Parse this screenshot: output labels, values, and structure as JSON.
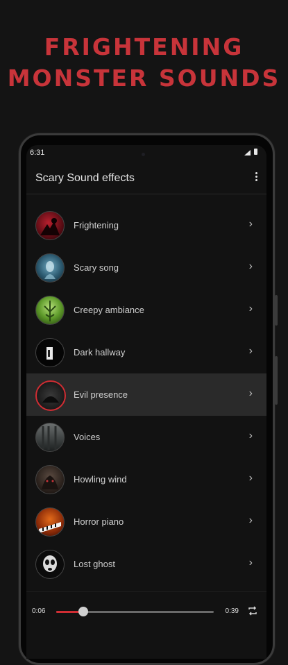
{
  "headline": {
    "line1": "FRIGHTENING",
    "line2": "MONSTER SOUNDS"
  },
  "status": {
    "time": "6:31"
  },
  "app": {
    "title": "Scary Sound effects"
  },
  "list": {
    "items": [
      {
        "label": "Frightening"
      },
      {
        "label": "Scary song"
      },
      {
        "label": "Creepy ambiance"
      },
      {
        "label": "Dark hallway"
      },
      {
        "label": "Evil presence"
      },
      {
        "label": "Voices"
      },
      {
        "label": "Howling wind"
      },
      {
        "label": "Horror piano"
      },
      {
        "label": "Lost ghost"
      }
    ],
    "chevron": "›"
  },
  "player": {
    "current": "0:06",
    "total": "0:39",
    "progress": 0.17
  },
  "colors": {
    "accent": "#d02d33",
    "background": "#141414",
    "headline": "#c8343a"
  }
}
